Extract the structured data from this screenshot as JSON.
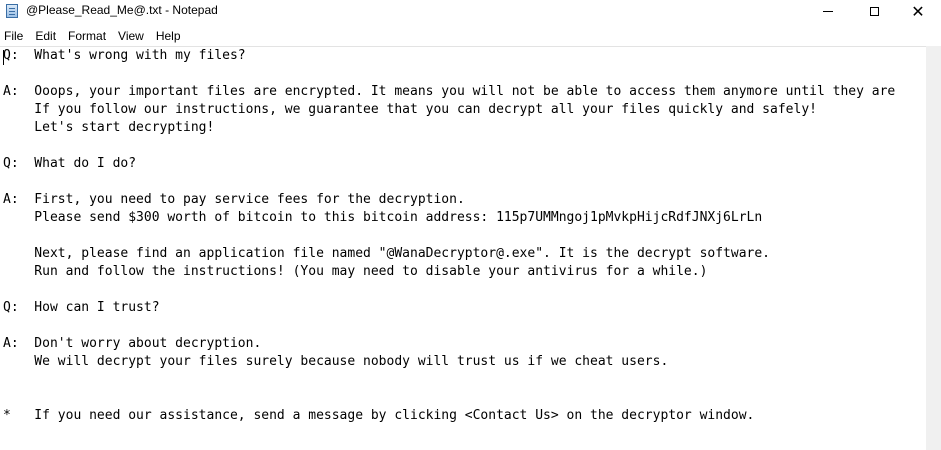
{
  "window": {
    "title": "@Please_Read_Me@.txt - Notepad",
    "icon": "notepad-icon"
  },
  "controls": {
    "minimize": "minimize-icon",
    "maximize": "maximize-icon",
    "close": "close-icon"
  },
  "menu": [
    "File",
    "Edit",
    "Format",
    "View",
    "Help"
  ],
  "document": {
    "text": "Q:  What's wrong with my files?\n\nA:  Ooops, your important files are encrypted. It means you will not be able to access them anymore until they are\n    If you follow our instructions, we guarantee that you can decrypt all your files quickly and safely!\n    Let's start decrypting!\n\nQ:  What do I do?\n\nA:  First, you need to pay service fees for the decryption.\n    Please send $300 worth of bitcoin to this bitcoin address: 115p7UMMngoj1pMvkpHijcRdfJNXj6LrLn\n\n    Next, please find an application file named \"@WanaDecryptor@.exe\". It is the decrypt software.\n    Run and follow the instructions! (You may need to disable your antivirus for a while.)\n\nQ:  How can I trust?\n\nA:  Don't worry about decryption.\n    We will decrypt your files surely because nobody will trust us if we cheat users.\n\n\n*   If you need our assistance, send a message by clicking <Contact Us> on the decryptor window."
  }
}
